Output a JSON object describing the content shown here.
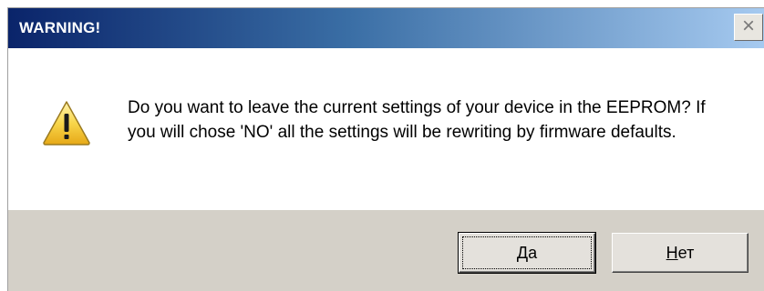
{
  "window": {
    "title": "WARNING!",
    "close_icon": "×"
  },
  "message": {
    "icon": "warning-icon",
    "text": "Do you want to leave the current settings of your device in the EEPROM? If you will chose 'NO' all the settings will be rewriting by firmware defaults."
  },
  "buttons": {
    "yes_accel": "Д",
    "yes_rest": "а",
    "no_accel": "Н",
    "no_rest": "ет"
  },
  "colors": {
    "titlebar_start": "#0a246a",
    "titlebar_end": "#a6caf0",
    "footer": "#d4d0c8",
    "warning_fill": "#f4c430"
  }
}
